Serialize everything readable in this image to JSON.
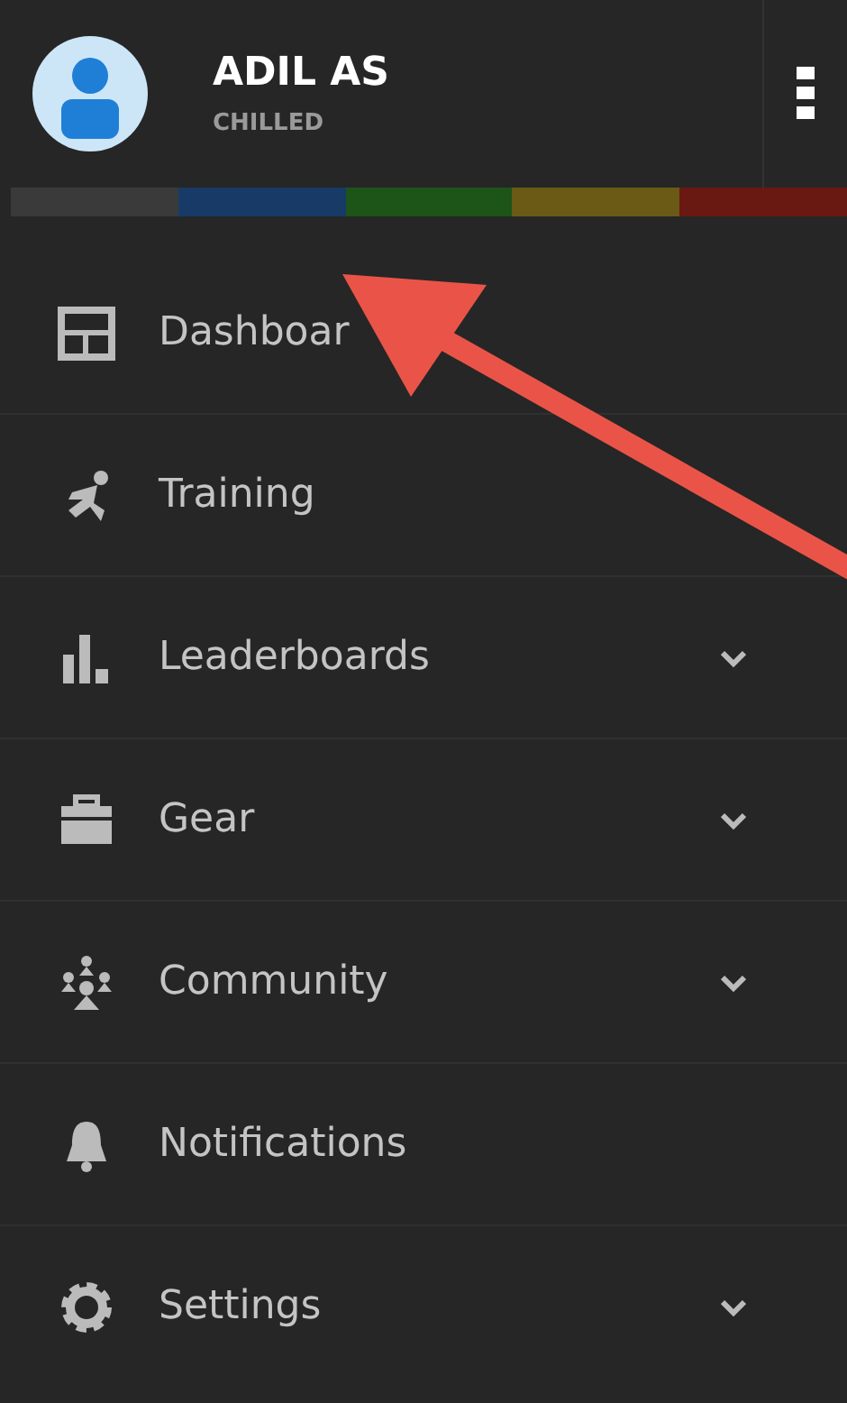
{
  "profile": {
    "name": "ADIL AS",
    "status": "CHILLED"
  },
  "color_bar": [
    {
      "color": "#3a3a3a"
    },
    {
      "color": "#173a66"
    },
    {
      "color": "#1d5418"
    },
    {
      "color": "#6a5a16"
    },
    {
      "color": "#6a1812"
    }
  ],
  "menu": [
    {
      "label": "Dashboar",
      "expandable": false
    },
    {
      "label": "Training",
      "expandable": false
    },
    {
      "label": "Leaderboards",
      "expandable": true
    },
    {
      "label": "Gear",
      "expandable": true
    },
    {
      "label": "Community",
      "expandable": true
    },
    {
      "label": "Notifications",
      "expandable": false
    },
    {
      "label": "Settings",
      "expandable": true
    }
  ]
}
